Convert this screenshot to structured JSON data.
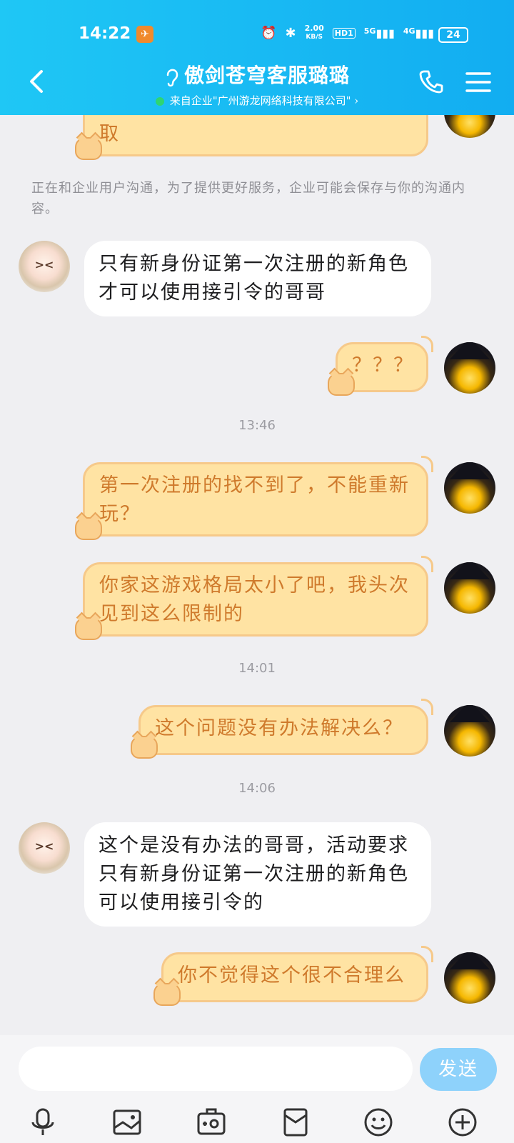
{
  "status_bar": {
    "time": "14:22",
    "net_speed": "2.00",
    "net_unit": "KB/S",
    "hd": "HD1",
    "sig1": "5G",
    "sig2": "4G",
    "battery": "24"
  },
  "header": {
    "title": "傲剑苍穹客服璐璐",
    "subtitle": "来自企业\"广州游龙网络科技有限公司\"",
    "accent": "#16b6f3"
  },
  "chat": {
    "partial_top": "取",
    "notice": "正在和企业用户沟通，为了提供更好服务，企业可能会保存与你的沟通内容。",
    "messages": [
      {
        "from": "service",
        "text": "只有新身份证第一次注册的新角色才可以使用接引令的哥哥"
      },
      {
        "from": "me",
        "text": "？？？"
      },
      {
        "from": "time",
        "text": "13:46"
      },
      {
        "from": "me",
        "text": "第一次注册的找不到了，不能重新玩？"
      },
      {
        "from": "me",
        "text": "你家这游戏格局太小了吧，我头次见到这么限制的"
      },
      {
        "from": "time",
        "text": "14:01"
      },
      {
        "from": "me",
        "text": "这个问题没有办法解决么？"
      },
      {
        "from": "time",
        "text": "14:06"
      },
      {
        "from": "service",
        "text": "这个是没有办法的哥哥，活动要求只有新身份证第一次注册的新角色可以使用接引令的"
      },
      {
        "from": "me",
        "text": "你不觉得这个很不合理么"
      }
    ]
  },
  "input": {
    "placeholder": "",
    "send_label": "发送"
  },
  "colors": {
    "my_bubble": "#ffe3a3",
    "my_text": "#cf7a2c",
    "other_bubble": "#ffffff",
    "background": "#efeff2",
    "send_button": "#8ed2fb"
  }
}
